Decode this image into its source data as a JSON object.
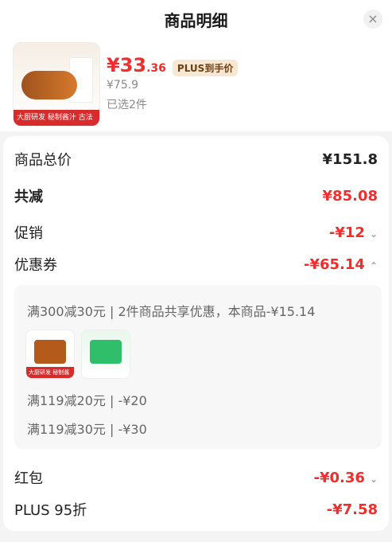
{
  "header": {
    "title": "商品明细",
    "close_icon": "close-icon"
  },
  "product": {
    "thumb_label": "大厨研发 秘制酱汁  古法秘制块块筋脆",
    "price_main": "¥33",
    "price_decimal": ".36",
    "plus_tag": "PLUS到手价",
    "original_price": "¥75.9",
    "selected": "已选2件"
  },
  "summary": {
    "total_label": "商品总价",
    "total_value": "¥151.8",
    "reduction_label": "共减",
    "reduction_value": "¥85.08",
    "promo_label": "促销",
    "promo_value": "-¥12",
    "coupon_label": "优惠券",
    "coupon_value": "-¥65.14",
    "coupon_details": {
      "line1": "满300减30元 | 2件商品共享优惠，本商品-¥15.14",
      "line2": "满119减20元 | -¥20",
      "line3": "满119减30元 | -¥30",
      "mini_thumb_1_label": "大厨研发 秘制酱汁",
      "mini_thumb_2_label": ""
    },
    "hongbao_label": "红包",
    "hongbao_value": "-¥0.36",
    "plus95_label": "PLUS 95折",
    "plus95_value": "-¥7.58"
  }
}
